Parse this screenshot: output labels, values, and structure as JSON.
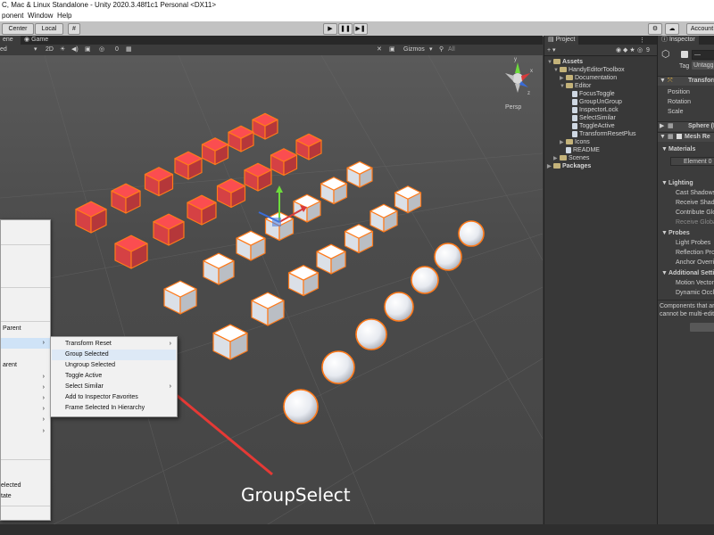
{
  "window": {
    "title": "C, Mac & Linux Standalone - Unity 2020.3.48f1c1 Personal <DX11>"
  },
  "menu": {
    "items": [
      "ponent",
      "Window",
      "Help"
    ]
  },
  "toolbar": {
    "center": "Center",
    "local": "Local",
    "account": "Account"
  },
  "scene": {
    "tabs": [
      "ene",
      "Game"
    ],
    "shading": "ed",
    "mode_2d": "2D",
    "gizmo_count": "0",
    "gizmos": "Gizmos",
    "search_placeholder": "All",
    "persp": "Persp"
  },
  "project": {
    "tab": "Project",
    "count": "9",
    "tree": [
      {
        "label": "Assets",
        "bold": true
      },
      {
        "label": "HandyEditorToolbox"
      },
      {
        "label": "Documentation"
      },
      {
        "label": "Editor"
      },
      {
        "label": "FocusToggle"
      },
      {
        "label": "GroupUnGroup"
      },
      {
        "label": "InspectorLock"
      },
      {
        "label": "SelectSimilar"
      },
      {
        "label": "ToggleActive"
      },
      {
        "label": "TransformResetPlus"
      },
      {
        "label": "Icons"
      },
      {
        "label": "README"
      },
      {
        "label": "Scenes"
      },
      {
        "label": "Packages",
        "bold": true
      }
    ]
  },
  "inspector": {
    "tab": "Inspector",
    "name_field": "—",
    "tag_label": "Tag",
    "tag_value": "Untagg",
    "transform": "Transform",
    "position": "Position",
    "rotation": "Rotation",
    "scale": "Scale",
    "sphere": "Sphere (I",
    "mesh_renderer": "Mesh Re",
    "materials": "Materials",
    "element": "Element 0",
    "lighting": "Lighting",
    "cast_shadows": "Cast Shadows",
    "receive_shadows": "Receive Shad",
    "contribute_gi": "Contribute Glo",
    "receive_gi": "Receive Globa",
    "probes": "Probes",
    "light_probes": "Light Probes",
    "reflection_probes": "Reflection Pro",
    "anchor_override": "Anchor Overri",
    "additional_settings": "Additional Setti",
    "motion_vectors": "Motion Vector",
    "dynamic_occlusion": "Dynamic Occl",
    "note_line1": "Components that ar",
    "note_line2": "cannot be multi-edit"
  },
  "context_menu": {
    "partial_items": [
      {
        "label": "Parent"
      },
      {
        "label": "arent"
      },
      {
        "label": "elected"
      },
      {
        "label": "tate"
      }
    ]
  },
  "submenu": {
    "items": [
      {
        "label": "Transform Reset",
        "arrow": true
      },
      {
        "label": "Group Selected",
        "arrow": false,
        "highlight": true
      },
      {
        "label": "Ungroup Selected",
        "arrow": false
      },
      {
        "label": "Toggle Active",
        "arrow": false
      },
      {
        "label": "Select Similar",
        "arrow": true
      },
      {
        "label": "Add to Inspector Favorites",
        "arrow": false
      },
      {
        "label": "Frame Selected In Hierarchy",
        "arrow": false
      }
    ]
  },
  "annotation": {
    "caption": "GroupSelect",
    "arrow_color": "#e53935"
  },
  "colors": {
    "selection_outline": "#ff7a1a",
    "red_cube": "#e8474a",
    "white_cube": "#eef3fb"
  }
}
